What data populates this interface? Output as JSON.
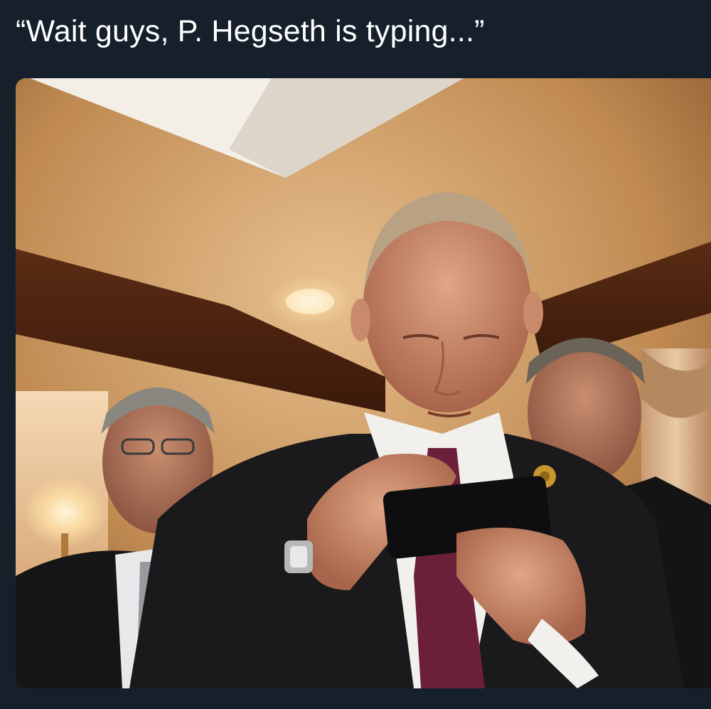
{
  "post": {
    "caption": "“Wait guys, P. Hegseth is typing...”"
  },
  "photo": {
    "alt": "Man in a dark suit looking down at a smartphone held in both hands, with two men standing behind him in a warmly lit room"
  },
  "colors": {
    "background": "#15202b",
    "caption_text": "#ffffff"
  }
}
